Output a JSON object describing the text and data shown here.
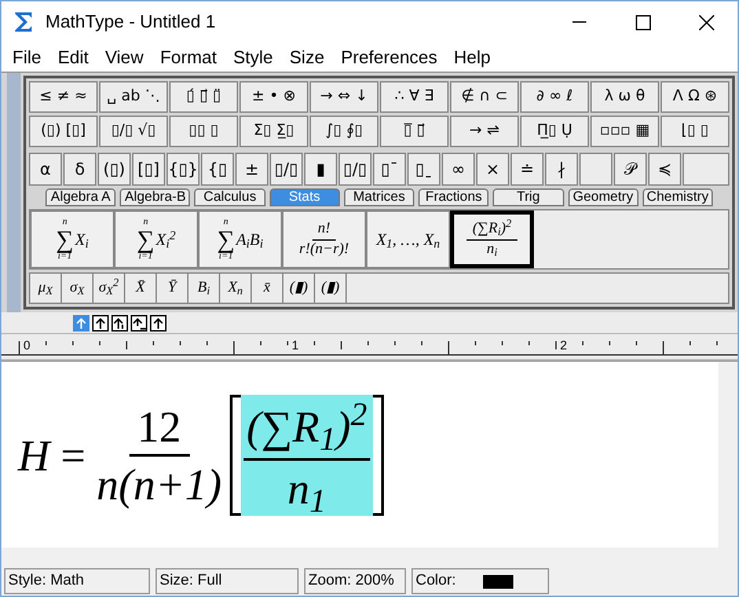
{
  "window": {
    "title": "MathType - Untitled 1"
  },
  "menu": [
    "File",
    "Edit",
    "View",
    "Format",
    "Style",
    "Size",
    "Preferences",
    "Help"
  ],
  "palette_row_1": [
    "≤ ≠ ≈",
    "␣ ab ⋱",
    "▯́ ▯⃗ ▯̈",
    "± • ⊗",
    "→ ⇔ ↓",
    "∴ ∀ ∃",
    "∉ ∩ ⊂",
    "∂ ∞ ℓ",
    "λ ω θ",
    "Λ Ω ⊛"
  ],
  "palette_row_2": [
    "(▯) [▯]",
    "▯/▯ √▯",
    "▯▯ ▯",
    "Σ▯ Σ̲▯",
    "∫▯ ∮▯",
    "▯̅ ▯⃗",
    "→ ⇌",
    "Π̲▯ Ụ",
    "▫▫▫ ▦",
    "⌊▯ ▯"
  ],
  "symbol_row": [
    {
      "kind": "symbol",
      "text": "α"
    },
    {
      "kind": "symbol",
      "text": "δ"
    },
    {
      "kind": "symbol",
      "text": "(▯)"
    },
    {
      "kind": "symbol",
      "text": "[▯]"
    },
    {
      "kind": "symbol",
      "text": "{▯}"
    },
    {
      "kind": "symbol",
      "text": "{▯"
    },
    {
      "kind": "symbol",
      "text": "±"
    },
    {
      "kind": "symbol",
      "text": "▯/▯"
    },
    {
      "kind": "symbol",
      "text": "▮"
    },
    {
      "kind": "symbol",
      "text": "▯/▯"
    },
    {
      "kind": "symbol",
      "text": "▯ˉ"
    },
    {
      "kind": "symbol",
      "text": "▯ˍ"
    },
    {
      "kind": "symbol",
      "text": "∞"
    },
    {
      "kind": "symbol",
      "text": "×"
    },
    {
      "kind": "symbol",
      "text": "≐"
    },
    {
      "kind": "symbol",
      "text": "∤"
    },
    {
      "kind": "blank"
    },
    {
      "kind": "symbol",
      "text": "𝒫"
    },
    {
      "kind": "symbol",
      "text": "≼"
    }
  ],
  "tabs": [
    {
      "label": "Algebra A",
      "selected": false
    },
    {
      "label": "Algebra-B",
      "selected": false
    },
    {
      "label": "Calculus",
      "selected": false
    },
    {
      "label": "Stats",
      "selected": true
    },
    {
      "label": "Matrices",
      "selected": false
    },
    {
      "label": "Fractions",
      "selected": false
    },
    {
      "label": "Trig",
      "selected": false
    },
    {
      "label": "Geometry",
      "selected": false
    },
    {
      "label": "Chemistry",
      "selected": false
    }
  ],
  "stats_templates": [
    {
      "kind": "sum",
      "sign": "∑",
      "upper": "n",
      "lower": "i=1",
      "body": "X$_{i}$",
      "selected": false
    },
    {
      "kind": "sum",
      "sign": "∑",
      "upper": "n",
      "lower": "i=1",
      "body": "X$_{i}$$^{2}$",
      "selected": false
    },
    {
      "kind": "sum",
      "sign": "∑",
      "upper": "n",
      "lower": "i=1",
      "body": "A$_{i}$B$_{i}$",
      "selected": false
    },
    {
      "kind": "fraction",
      "num": "n!",
      "den": "r!(n−r)!",
      "selected": false
    },
    {
      "kind": "text",
      "text": "X$_{1}$, …, X$_{n}$",
      "selected": false
    },
    {
      "kind": "fraction",
      "num": "(∑R$_{i}$)$^{2}$",
      "den": "n$_{i}$",
      "selected": true
    }
  ],
  "stats_symbols": [
    "μ$_{X}$",
    "σ$_{X}$",
    "σ$_{X}$$^{2}$",
    "X̄",
    "Ȳ",
    "B$_{i}$",
    "X$_{n}$",
    "x̄",
    "(▮)",
    "(▮)"
  ],
  "alignment_buttons": [
    {
      "selected": true
    },
    {
      "selected": false
    },
    {
      "selected": false
    },
    {
      "selected": false
    },
    {
      "selected": false
    }
  ],
  "ruler": {
    "labels": [
      "0",
      "1",
      "2"
    ]
  },
  "equation": {
    "lhs": "H",
    "equals": "=",
    "fraction": {
      "num": "12",
      "den": "n(n+1)"
    },
    "bracketed": {
      "num": "(∑R$_{1}$)$^{2}$",
      "den": "n$_{1}$",
      "selected": true
    }
  },
  "status_bar": {
    "style": "Style: Math",
    "size": "Size: Full",
    "zoom": "Zoom: 200%",
    "color_label": "Color:",
    "color": "#000000"
  }
}
